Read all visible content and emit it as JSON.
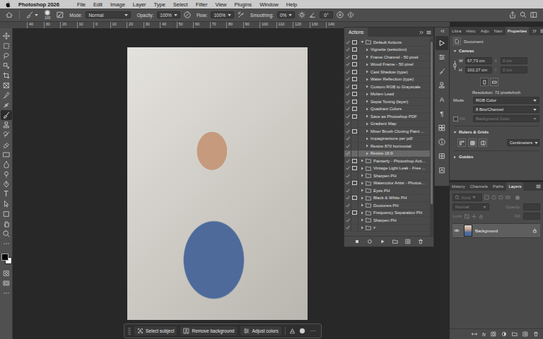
{
  "menubar": {
    "app_name": "Photoshop 2026",
    "items": [
      "File",
      "Edit",
      "Image",
      "Layer",
      "Type",
      "Select",
      "Filter",
      "View",
      "Plugins",
      "Window",
      "Help"
    ]
  },
  "options_bar": {
    "brush_size": "100",
    "mode_label": "Mode:",
    "mode_value": "Normal",
    "opacity_label": "Opacity:",
    "opacity_value": "100%",
    "flow_label": "Flow:",
    "flow_value": "100%",
    "smoothing_label": "Smoothing:",
    "smoothing_value": "0%",
    "angle_value": "0°"
  },
  "ruler": {
    "ticks": [
      "40",
      "30",
      "20",
      "10",
      "0",
      "10",
      "20",
      "30",
      "40",
      "50",
      "60",
      "70",
      "80",
      "90",
      "100",
      "110",
      "120",
      "130",
      "140"
    ]
  },
  "toolbar": {
    "tools": [
      {
        "selected": false
      },
      {
        "selected": false
      },
      {
        "selected": false
      },
      {
        "selected": false
      },
      {
        "selected": false
      },
      {
        "selected": false
      },
      {
        "selected": false
      },
      {
        "selected": false
      },
      {
        "selected": true
      },
      {
        "selected": false
      },
      {
        "selected": false
      },
      {
        "selected": false
      },
      {
        "selected": false
      },
      {
        "selected": false
      },
      {
        "selected": false
      },
      {
        "selected": false
      },
      {
        "selected": false,
        "glyph": "T"
      },
      {
        "selected": false
      },
      {
        "selected": false
      },
      {
        "selected": false
      },
      {
        "selected": false
      },
      {
        "selected": false
      }
    ]
  },
  "side_strip": {
    "items": [
      {
        "selected": true
      },
      {
        "selected": false
      },
      {
        "selected": false
      },
      {
        "selected": false
      },
      {
        "selected": false,
        "glyph": "A"
      },
      {
        "selected": false,
        "glyph": "¶"
      },
      {
        "selected": false
      },
      {
        "selected": false
      },
      {
        "selected": false
      },
      {
        "selected": false
      }
    ]
  },
  "actions_panel": {
    "title": "Actions",
    "rows": [
      {
        "name": "Default Actions",
        "kind": "set",
        "checked": true,
        "dialog": true,
        "expanded": true,
        "selected": false
      },
      {
        "name": "Vignette (selection)",
        "kind": "action",
        "checked": true,
        "dialog": true,
        "expanded": false,
        "selected": false
      },
      {
        "name": "Frame Channel - 50 pixel",
        "kind": "action",
        "checked": true,
        "dialog": true,
        "expanded": false,
        "selected": false
      },
      {
        "name": "Wood Frame - 50 pixel",
        "kind": "action",
        "checked": true,
        "dialog": true,
        "expanded": false,
        "selected": false
      },
      {
        "name": "Cast Shadow (type)",
        "kind": "action",
        "checked": true,
        "dialog": true,
        "expanded": false,
        "selected": false
      },
      {
        "name": "Water Reflection (type)",
        "kind": "action",
        "checked": true,
        "dialog": true,
        "expanded": false,
        "selected": false
      },
      {
        "name": "Custom RGB to Grayscale",
        "kind": "action",
        "checked": true,
        "dialog": true,
        "expanded": false,
        "selected": false
      },
      {
        "name": "Molten Lead",
        "kind": "action",
        "checked": true,
        "dialog": true,
        "expanded": false,
        "selected": false
      },
      {
        "name": "Sepia Toning (layer)",
        "kind": "action",
        "checked": true,
        "dialog": true,
        "expanded": false,
        "selected": false
      },
      {
        "name": "Quadrant Colors",
        "kind": "action",
        "checked": true,
        "dialog": true,
        "expanded": false,
        "selected": false
      },
      {
        "name": "Save as Photoshop PDF",
        "kind": "action",
        "checked": true,
        "dialog": true,
        "expanded": false,
        "selected": false
      },
      {
        "name": "Gradient Map",
        "kind": "action",
        "checked": true,
        "dialog": false,
        "expanded": false,
        "selected": false
      },
      {
        "name": "Mixer Brush Cloning Paint ...",
        "kind": "action",
        "checked": true,
        "dialog": true,
        "expanded": false,
        "selected": false
      },
      {
        "name": "Impaginazione per pdf",
        "kind": "action",
        "checked": true,
        "dialog": false,
        "expanded": false,
        "selected": false
      },
      {
        "name": "Resize 870 horizontal",
        "kind": "action",
        "checked": true,
        "dialog": false,
        "expanded": false,
        "selected": false
      },
      {
        "name": "Resize 16:9",
        "kind": "action",
        "checked": true,
        "dialog": false,
        "expanded": false,
        "selected": true
      },
      {
        "name": "Painterly - Photoshop Acti...",
        "kind": "set",
        "checked": true,
        "dialog": true,
        "expanded": false,
        "selected": false
      },
      {
        "name": "Vintage Light Leak - Free ...",
        "kind": "set",
        "checked": true,
        "dialog": true,
        "expanded": false,
        "selected": false
      },
      {
        "name": "Sharpen PH",
        "kind": "set",
        "checked": true,
        "dialog": false,
        "expanded": false,
        "selected": false
      },
      {
        "name": "Watercolor Artist - Photos...",
        "kind": "set",
        "checked": true,
        "dialog": true,
        "expanded": false,
        "selected": false
      },
      {
        "name": "Eyes PH",
        "kind": "set",
        "checked": true,
        "dialog": false,
        "expanded": false,
        "selected": false
      },
      {
        "name": "Black & White PH",
        "kind": "set",
        "checked": true,
        "dialog": true,
        "expanded": false,
        "selected": false
      },
      {
        "name": "Duotones PH",
        "kind": "set",
        "checked": true,
        "dialog": false,
        "expanded": false,
        "selected": false
      },
      {
        "name": "Frequency Separation PH",
        "kind": "set",
        "checked": true,
        "dialog": true,
        "expanded": false,
        "selected": false
      },
      {
        "name": "Sharpen PH",
        "kind": "set",
        "checked": true,
        "dialog": false,
        "expanded": false,
        "selected": false
      },
      {
        "name": "z",
        "kind": "set",
        "checked": true,
        "dialog": false,
        "expanded": false,
        "selected": false
      }
    ]
  },
  "properties_panel": {
    "tabs": [
      {
        "label": "Libra",
        "selected": false
      },
      {
        "label": "Histc",
        "selected": false
      },
      {
        "label": "Adju",
        "selected": false
      },
      {
        "label": "Navi",
        "selected": false
      },
      {
        "label": "Properties",
        "selected": true
      }
    ],
    "document_label": "Document",
    "canvas": {
      "title": "Canvas",
      "expanded": true,
      "width_label": "W",
      "width_value": "67,73 cm",
      "height_label": "H",
      "height_value": "102,27 cm",
      "x_label": "X",
      "x_value": "0 cm",
      "y_label": "Y",
      "y_value": "0 cm",
      "position_disabled": true,
      "resolution": "Resolution: 72 pixels/inch",
      "mode_label": "Mode",
      "mode_value": "RGB Color",
      "depth_value": "8 Bits/Channel",
      "fill_label": "Fill",
      "fill_checked": false,
      "fill_value": "Background Color",
      "fill_disabled": true
    },
    "rulers": {
      "title": "Rulers & Grids",
      "expanded": true,
      "units": "Centimeters"
    },
    "guides": {
      "title": "Guides",
      "expanded": false
    }
  },
  "layers_panel": {
    "tabs": [
      {
        "label": "History",
        "selected": false
      },
      {
        "label": "Channels",
        "selected": false
      },
      {
        "label": "Paths",
        "selected": false
      },
      {
        "label": "Layers",
        "selected": true
      }
    ],
    "filter_value": "Kind",
    "blend_mode": "Normal",
    "opacity_label": "Opacity:",
    "lock_label": "Lock:",
    "fill_label": "Fill:",
    "controls_disabled": true,
    "layers": [
      {
        "name": "Background",
        "visible": true,
        "locked": true,
        "selected": true
      }
    ],
    "effects_glyph": "fx"
  },
  "task_bar": {
    "buttons": [
      {
        "label": "Select subject"
      },
      {
        "label": "Remove background"
      },
      {
        "label": "Adjust colors"
      }
    ],
    "more": "···"
  }
}
